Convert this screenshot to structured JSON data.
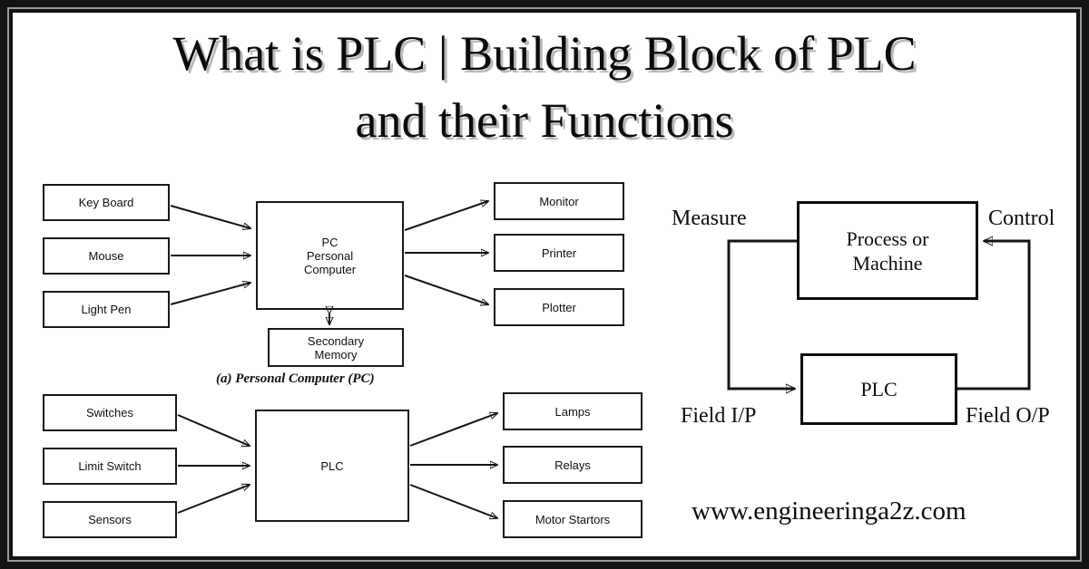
{
  "title": {
    "line1": "What is PLC | Building Block of PLC",
    "line2": "and their Functions"
  },
  "watermark": {
    "url": "www.engineeringa2z.com"
  },
  "diagram_pc": {
    "caption": "(a) Personal Computer (PC)",
    "inputs": [
      {
        "label": "Key Board"
      },
      {
        "label": "Mouse"
      },
      {
        "label": "Light Pen"
      }
    ],
    "center": {
      "line1": "PC",
      "line2": "Personal",
      "line3": "Computer"
    },
    "storage": {
      "line1": "Secondary",
      "line2": "Memory"
    },
    "outputs": [
      {
        "label": "Monitor"
      },
      {
        "label": "Printer"
      },
      {
        "label": "Plotter"
      }
    ]
  },
  "diagram_plc": {
    "inputs": [
      {
        "label": "Switches"
      },
      {
        "label": "Limit Switch"
      },
      {
        "label": "Sensors"
      }
    ],
    "center": {
      "label": "PLC"
    },
    "outputs": [
      {
        "label": "Lamps"
      },
      {
        "label": "Relays"
      },
      {
        "label": "Motor Startors"
      }
    ]
  },
  "diagram_loop": {
    "process": {
      "line1": "Process or",
      "line2": "Machine"
    },
    "controller": {
      "label": "PLC"
    },
    "labels": {
      "measure": "Measure",
      "control": "Control",
      "field_ip": "Field I/P",
      "field_op": "Field O/P"
    }
  },
  "colors": {
    "frame": "#141414",
    "frame_inner_line": "#9a9a9a",
    "page": "#ffffff",
    "ink": "#111111",
    "title_shadow": "#b9b9b9"
  }
}
